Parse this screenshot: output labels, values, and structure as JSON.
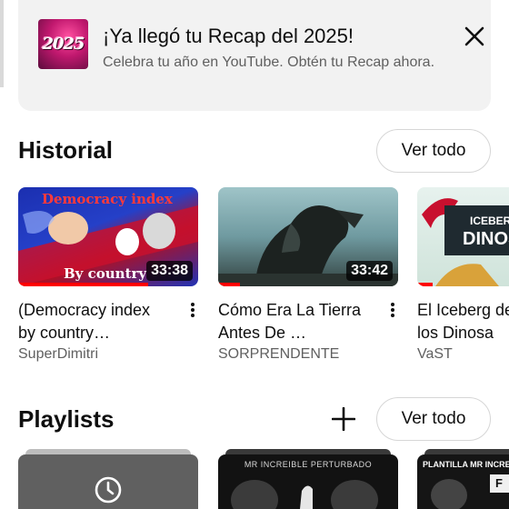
{
  "recap": {
    "thumb_text": "2025",
    "title": "¡Ya llegó tu Recap del 2025!",
    "subtitle": "Celebra tu año en YouTube. Obtén tu Recap ahora."
  },
  "history": {
    "title": "Historial",
    "view_all": "Ver todo",
    "videos": [
      {
        "title": "(Democracy index by country…",
        "channel": "SuperDimitri",
        "duration": "33:38",
        "thumb_text_top": "Democracy index",
        "thumb_text_bottom": "By country",
        "watched_fraction": 0.72
      },
      {
        "title": "Cómo Era La Tierra Antes De …",
        "channel": "SORPRENDENTE",
        "duration": "33:42",
        "watched_fraction": 0.12
      },
      {
        "title": "El Iceberg de los Dinosa",
        "channel": "VaST",
        "thumb_text_top": "ICEBERG",
        "thumb_text_bottom": "DINOSA",
        "watched_fraction": 0.15
      }
    ]
  },
  "playlists": {
    "title": "Playlists",
    "view_all": "Ver todo",
    "items": [
      {
        "icon": "clock-icon"
      },
      {
        "thumb_text": "Mr Increible Perturbado"
      },
      {
        "thumb_text": "Plantilla Mr Increi",
        "badge": "F"
      }
    ]
  },
  "colors": {
    "progress": "#ff0000",
    "banner_bg": "#f2f2f2",
    "secondary_text": "#606060"
  }
}
